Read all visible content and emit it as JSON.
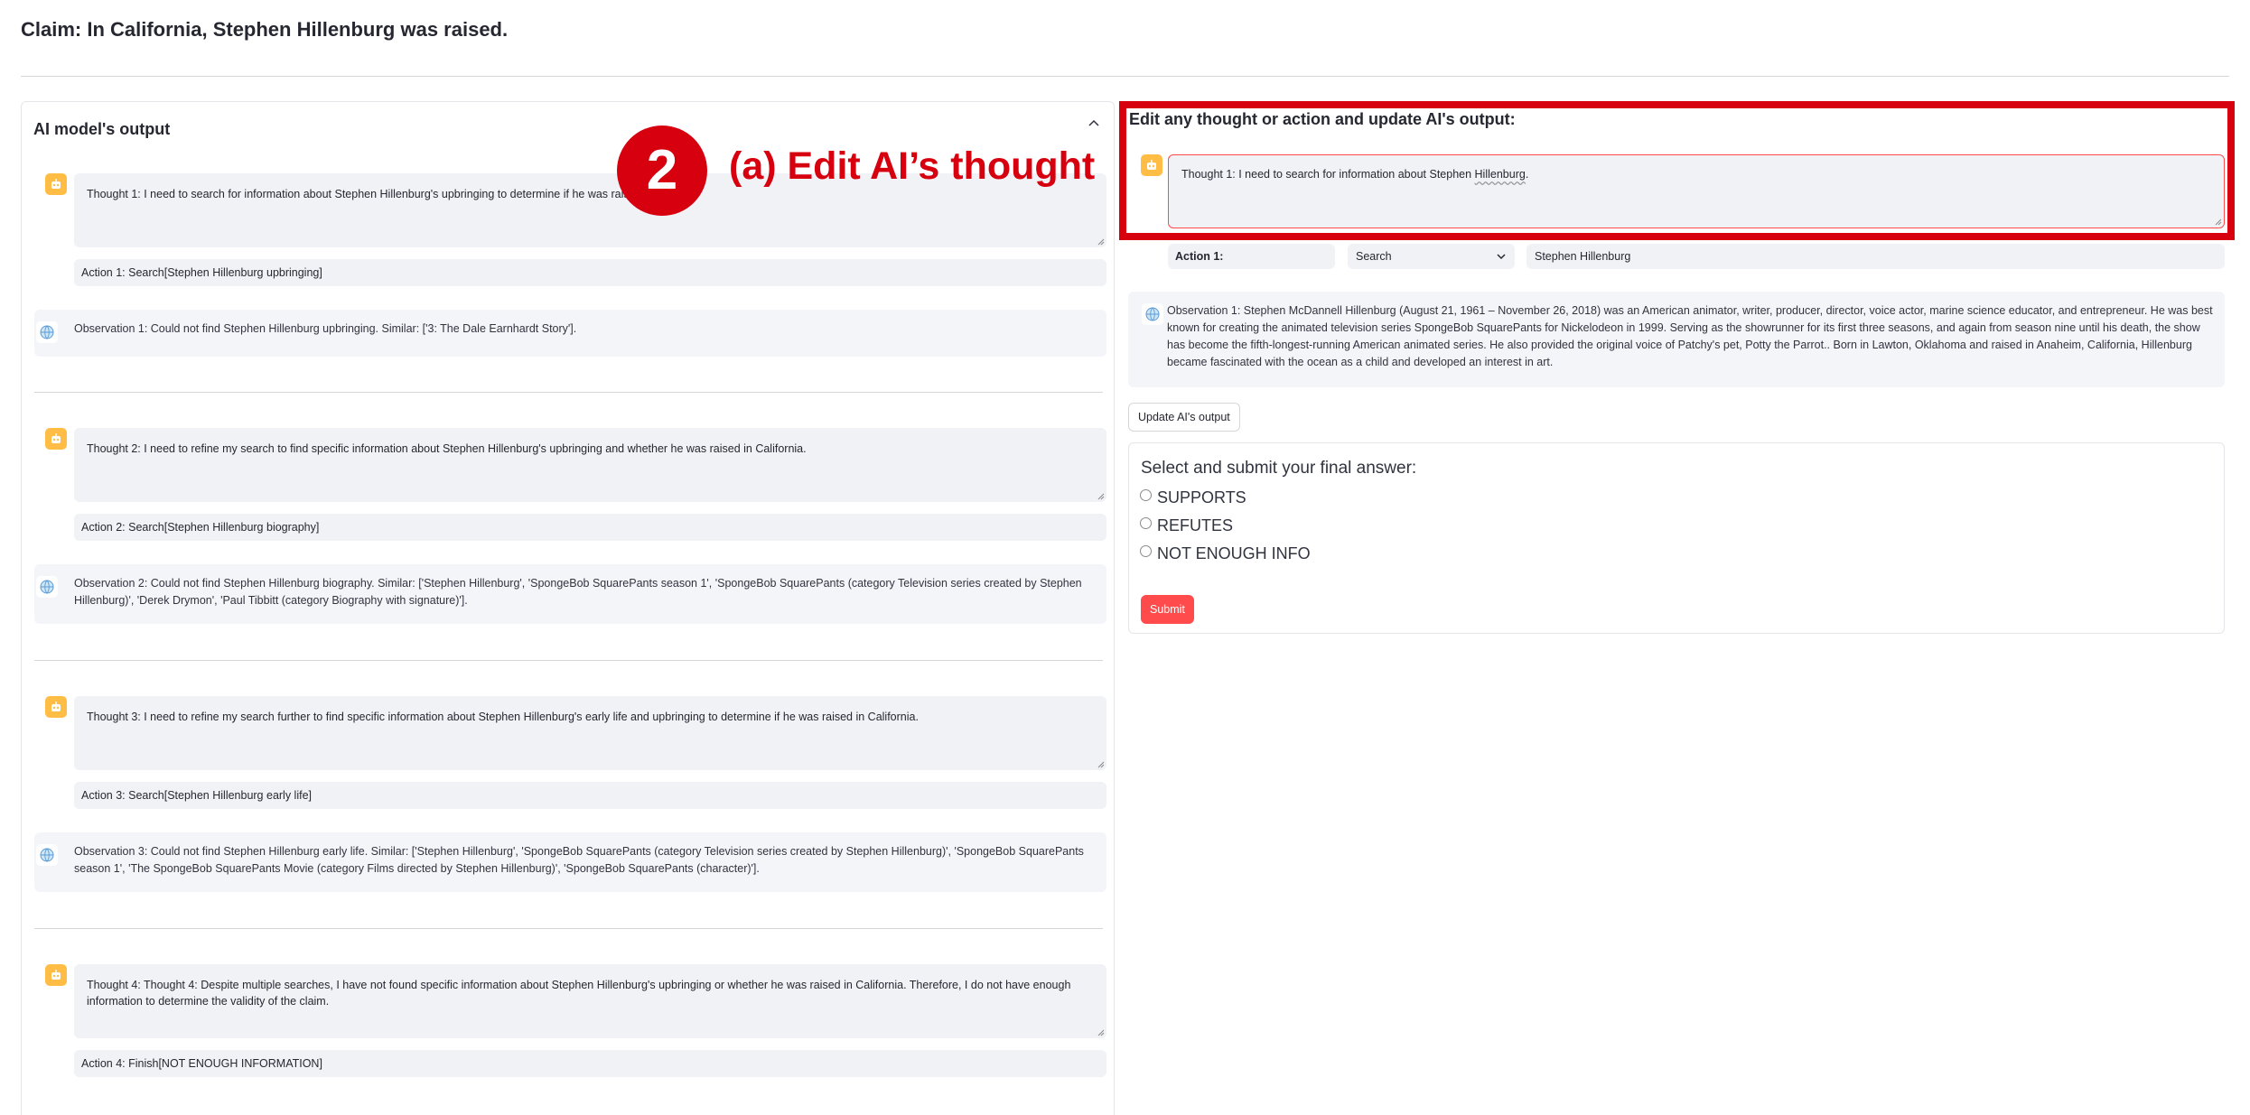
{
  "claim": "Claim: In California, Stephen Hillenburg was raised.",
  "left": {
    "title": "AI model's output",
    "steps": [
      {
        "thought": "Thought 1: I need to search for information about Stephen Hillenburg's upbringing to determine if he was raised",
        "action": "Action 1: Search[Stephen Hillenburg upbringing]",
        "observation": "Observation 1: Could not find Stephen Hillenburg upbringing. Similar: ['3: The Dale Earnhardt Story']."
      },
      {
        "thought": "Thought 2: I need to refine my search to find specific information about Stephen Hillenburg's upbringing and whether he was raised in California.",
        "action": "Action 2: Search[Stephen Hillenburg biography]",
        "observation": "Observation 2: Could not find Stephen Hillenburg biography. Similar: ['Stephen Hillenburg', 'SpongeBob SquarePants season 1', 'SpongeBob SquarePants (category Television series created by Stephen Hillenburg)', 'Derek Drymon', 'Paul Tibbitt (category Biography with signature)']."
      },
      {
        "thought": "Thought 3: I need to refine my search further to find specific information about Stephen Hillenburg's early life and upbringing to determine if he was raised in California.",
        "action": "Action 3: Search[Stephen Hillenburg early life]",
        "observation": "Observation 3: Could not find Stephen Hillenburg early life. Similar: ['Stephen Hillenburg', 'SpongeBob SquarePants (category Television series created by Stephen Hillenburg)', 'SpongeBob SquarePants season 1', 'The SpongeBob SquarePants Movie (category Films directed by Stephen Hillenburg)', 'SpongeBob SquarePants (character)']."
      },
      {
        "thought": "Thought 4: Thought 4: Despite multiple searches, I have not found specific information about Stephen Hillenburg's upbringing or whether he was raised in California. Therefore, I do not have enough information to determine the validity of the claim.",
        "action": "Action 4: Finish[NOT ENOUGH INFORMATION]"
      }
    ]
  },
  "annotation": {
    "number": "2",
    "label": "(a) Edit AI’s thought"
  },
  "right": {
    "title": "Edit any thought or action and update AI's output:",
    "thought_prefix": "Thought 1: I need to search for information about Stephen ",
    "thought_misspelled": "Hillenburg",
    "thought_suffix": ".",
    "action_label": "Action 1:",
    "action_type": "Search",
    "action_value": "Stephen Hillenburg",
    "observation": "Observation 1: Stephen McDannell Hillenburg (August 21, 1961 – November 26, 2018) was an American animator, writer, producer, director, voice actor, marine science educator, and entrepreneur. He was best known for creating the animated television series SpongeBob SquarePants for Nickelodeon in 1999. Serving as the showrunner for its first three seasons, and again from season nine until his death, the show has become the fifth-longest-running American animated series. He also provided the original voice of Patchy's pet, Potty the Parrot.. Born in Lawton, Oklahoma and raised in Anaheim, California, Hillenburg became fascinated with the ocean as a child and developed an interest in art.",
    "update_button": "Update AI's output",
    "form": {
      "title": "Select and submit your final answer:",
      "options": [
        "SUPPORTS",
        "REFUTES",
        "NOT ENOUGH INFO"
      ],
      "submit": "Submit"
    }
  },
  "colors": {
    "accent_red": "#d7000f",
    "streamlit_red": "#ff4b4b",
    "bot_icon": "#ffbd45",
    "field_bg": "#f0f2f6"
  }
}
